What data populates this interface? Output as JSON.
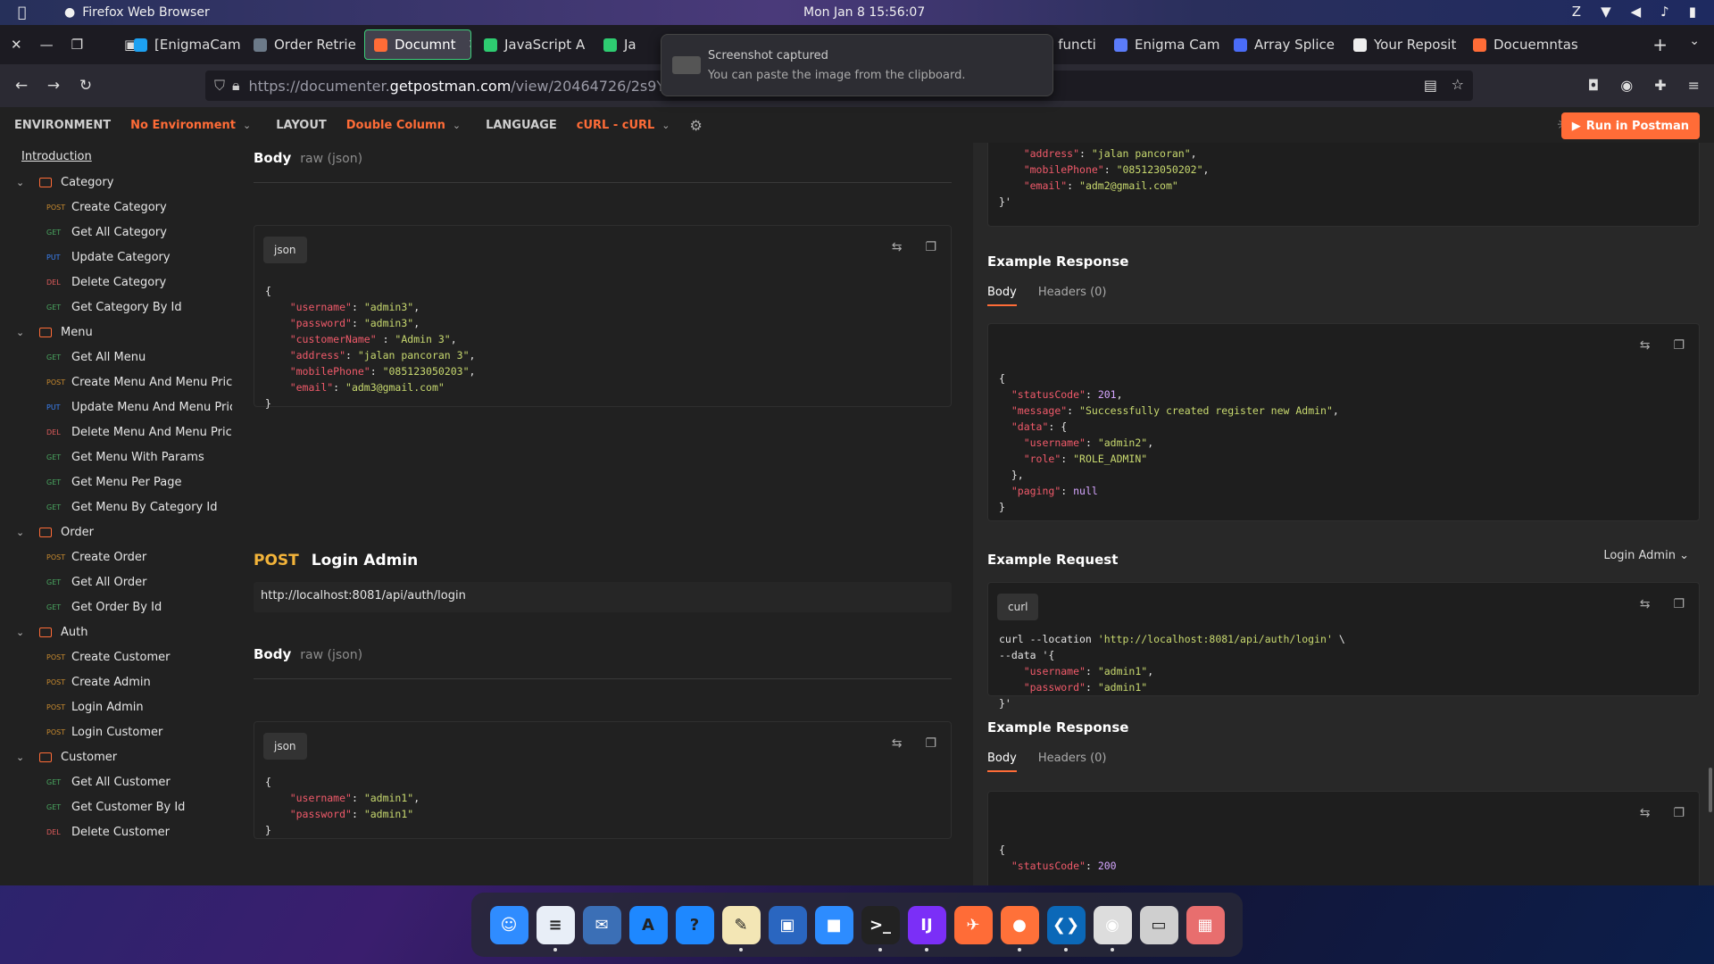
{
  "menubar": {
    "app_name": "Firefox Web Browser",
    "clock": "Mon Jan 8  15:56:07"
  },
  "tabs": [
    {
      "label": "[EnigmaCam",
      "color": "#1da1f2"
    },
    {
      "label": "Order Retrie",
      "color": "#6c7a89"
    },
    {
      "label": "Documnt",
      "color": "#ff6c37",
      "active": true
    },
    {
      "label": "JavaScript A",
      "color": "#2ecc71"
    },
    {
      "label": "Ja",
      "color": "#2ecc71"
    },
    {
      "label": "Arrow functi",
      "color": "#c9a227"
    },
    {
      "label": "Enigma Cam",
      "color": "#5b7cfa"
    },
    {
      "label": "Array Splice",
      "color": "#4a6cf7"
    },
    {
      "label": "Your Reposit",
      "color": "#eeeeee"
    },
    {
      "label": "Docuemntas",
      "color": "#ff6c37"
    }
  ],
  "navbar": {
    "url_prefix": "https://documenter.",
    "url_host": "getpostman.com",
    "url_path": "/view/20464726/2s9YsJBC"
  },
  "toast": {
    "title": "Screenshot captured",
    "body": "You can paste the image from the clipboard."
  },
  "postman": {
    "env_label": "ENVIRONMENT",
    "env_value": "No Environment",
    "layout_label": "LAYOUT",
    "layout_value": "Double Column",
    "language_label": "LANGUAGE",
    "language_value": "cURL - cURL",
    "run_label": "Run in Postman"
  },
  "sidebar": {
    "intro": "Introduction",
    "items": [
      {
        "kind": "folder",
        "label": "Category"
      },
      {
        "kind": "req",
        "method": "POST",
        "label": "Create Category"
      },
      {
        "kind": "req",
        "method": "GET",
        "label": "Get All Category"
      },
      {
        "kind": "req",
        "method": "PUT",
        "label": "Update Category"
      },
      {
        "kind": "req",
        "method": "DEL",
        "label": "Delete Category"
      },
      {
        "kind": "req",
        "method": "GET",
        "label": "Get Category By Id"
      },
      {
        "kind": "folder",
        "label": "Menu"
      },
      {
        "kind": "req",
        "method": "GET",
        "label": "Get All Menu"
      },
      {
        "kind": "req",
        "method": "POST",
        "label": "Create Menu And Menu Price"
      },
      {
        "kind": "req",
        "method": "PUT",
        "label": "Update Menu And Menu Price"
      },
      {
        "kind": "req",
        "method": "DEL",
        "label": "Delete Menu And Menu Price"
      },
      {
        "kind": "req",
        "method": "GET",
        "label": "Get Menu With Params"
      },
      {
        "kind": "req",
        "method": "GET",
        "label": "Get Menu Per Page"
      },
      {
        "kind": "req",
        "method": "GET",
        "label": "Get Menu By Category Id"
      },
      {
        "kind": "folder",
        "label": "Order"
      },
      {
        "kind": "req",
        "method": "POST",
        "label": "Create Order"
      },
      {
        "kind": "req",
        "method": "GET",
        "label": "Get All Order"
      },
      {
        "kind": "req",
        "method": "GET",
        "label": "Get Order By Id"
      },
      {
        "kind": "folder",
        "label": "Auth"
      },
      {
        "kind": "req",
        "method": "POST",
        "label": "Create Customer"
      },
      {
        "kind": "req",
        "method": "POST",
        "label": "Create Admin"
      },
      {
        "kind": "req",
        "method": "POST",
        "label": "Login Admin"
      },
      {
        "kind": "req",
        "method": "POST",
        "label": "Login Customer"
      },
      {
        "kind": "folder",
        "label": "Customer"
      },
      {
        "kind": "req",
        "method": "GET",
        "label": "Get All Customer"
      },
      {
        "kind": "req",
        "method": "GET",
        "label": "Get Customer By Id"
      },
      {
        "kind": "req",
        "method": "DEL",
        "label": "Delete Customer"
      }
    ]
  },
  "left": {
    "body1": {
      "title": "Body",
      "sub": "raw (json)",
      "lang": "json",
      "lines": [
        [
          "{"
        ],
        [
          "    ",
          "k:\"username\"",
          ": ",
          "s:\"admin3\"",
          ","
        ],
        [
          "    ",
          "k:\"password\"",
          ": ",
          "s:\"admin3\"",
          ","
        ],
        [
          "    ",
          "k:\"customerName\"",
          " : ",
          "s:\"Admin 3\"",
          ","
        ],
        [
          "    ",
          "k:\"address\"",
          ": ",
          "s:\"jalan pancoran 3\"",
          ","
        ],
        [
          "    ",
          "k:\"mobilePhone\"",
          ": ",
          "s:\"085123050203\"",
          ","
        ],
        [
          "    ",
          "k:\"email\"",
          ": ",
          "s:\"adm3@gmail.com\""
        ],
        [
          "}"
        ]
      ]
    },
    "request": {
      "method": "POST",
      "title": "Login Admin",
      "url": "http://localhost:8081/api/auth/login"
    },
    "body2": {
      "title": "Body",
      "sub": "raw (json)",
      "lang": "json",
      "lines": [
        [
          "{"
        ],
        [
          "    ",
          "k:\"username\"",
          ": ",
          "s:\"admin1\"",
          ","
        ],
        [
          "    ",
          "k:\"password\"",
          ": ",
          "s:\"admin1\""
        ],
        [
          "}"
        ]
      ]
    }
  },
  "right": {
    "top_lines": [
      [
        "    ",
        "k:\"address\"",
        ": ",
        "s:\"jalan pancoran\"",
        ","
      ],
      [
        "    ",
        "k:\"mobilePhone\"",
        ": ",
        "s:\"085123050202\"",
        ","
      ],
      [
        "    ",
        "k:\"email\"",
        ": ",
        "s:\"adm2@gmail.com\""
      ],
      [
        "}'"
      ]
    ],
    "ex_resp1": {
      "title": "Example Response",
      "tab_body": "Body",
      "tab_headers": "Headers (0)",
      "lines": [
        [
          "{"
        ],
        [
          "  ",
          "k:\"statusCode\"",
          ": ",
          "n:201",
          ","
        ],
        [
          "  ",
          "k:\"message\"",
          ": ",
          "s:\"Successfully created register new Admin\"",
          ","
        ],
        [
          "  ",
          "k:\"data\"",
          ": {"
        ],
        [
          "    ",
          "k:\"username\"",
          ": ",
          "s:\"admin2\"",
          ","
        ],
        [
          "    ",
          "k:\"role\"",
          ": ",
          "s:\"ROLE_ADMIN\""
        ],
        [
          "  },"
        ],
        [
          "  ",
          "k:\"paging\"",
          ": ",
          "n:null"
        ],
        [
          "}"
        ]
      ]
    },
    "ex_req": {
      "title": "Example Request",
      "select": "Login Admin",
      "lang": "curl",
      "lines": [
        [
          "curl --location ",
          "s:'http://localhost:8081/api/auth/login'",
          " \\"
        ],
        [
          "--data '{"
        ],
        [
          "    ",
          "k:\"username\"",
          ": ",
          "s:\"admin1\"",
          ","
        ],
        [
          "    ",
          "k:\"password\"",
          ": ",
          "s:\"admin1\""
        ],
        [
          "}'"
        ]
      ]
    },
    "ex_resp2": {
      "title": "Example Response",
      "tab_body": "Body",
      "tab_headers": "Headers (0)",
      "lines": [
        [
          "{"
        ],
        [
          "  ",
          "k:\"statusCode\"",
          ": ",
          "n:200"
        ]
      ]
    }
  },
  "dock": [
    {
      "name": "finder",
      "color": "#2f8cff",
      "glyph": "☺"
    },
    {
      "name": "text-editor",
      "color": "#e8eef7",
      "glyph": "≡"
    },
    {
      "name": "mail",
      "color": "#3b6fb6",
      "glyph": "✉"
    },
    {
      "name": "app-store",
      "color": "#1e88ff",
      "glyph": "A"
    },
    {
      "name": "help",
      "color": "#1e88ff",
      "glyph": "?"
    },
    {
      "name": "notes",
      "color": "#f3e6b5",
      "glyph": "✎"
    },
    {
      "name": "remote-desktop",
      "color": "#2a66c0",
      "glyph": "▣"
    },
    {
      "name": "zoom",
      "color": "#2d8cff",
      "glyph": "■"
    },
    {
      "name": "terminal",
      "color": "#222",
      "glyph": ">_"
    },
    {
      "name": "intellij",
      "color": "#7b2ff7",
      "glyph": "IJ"
    },
    {
      "name": "postman",
      "color": "#ff6c37",
      "glyph": "✈"
    },
    {
      "name": "firefox",
      "color": "#ff7139",
      "glyph": "●"
    },
    {
      "name": "vscode",
      "color": "#0b68b8",
      "glyph": "❮❯"
    },
    {
      "name": "chrome",
      "color": "#dddddd",
      "glyph": "◉"
    },
    {
      "name": "trash",
      "color": "#cfcfcf",
      "glyph": "▭"
    },
    {
      "name": "app-grid",
      "color": "#e86e6e",
      "glyph": "▦"
    }
  ]
}
